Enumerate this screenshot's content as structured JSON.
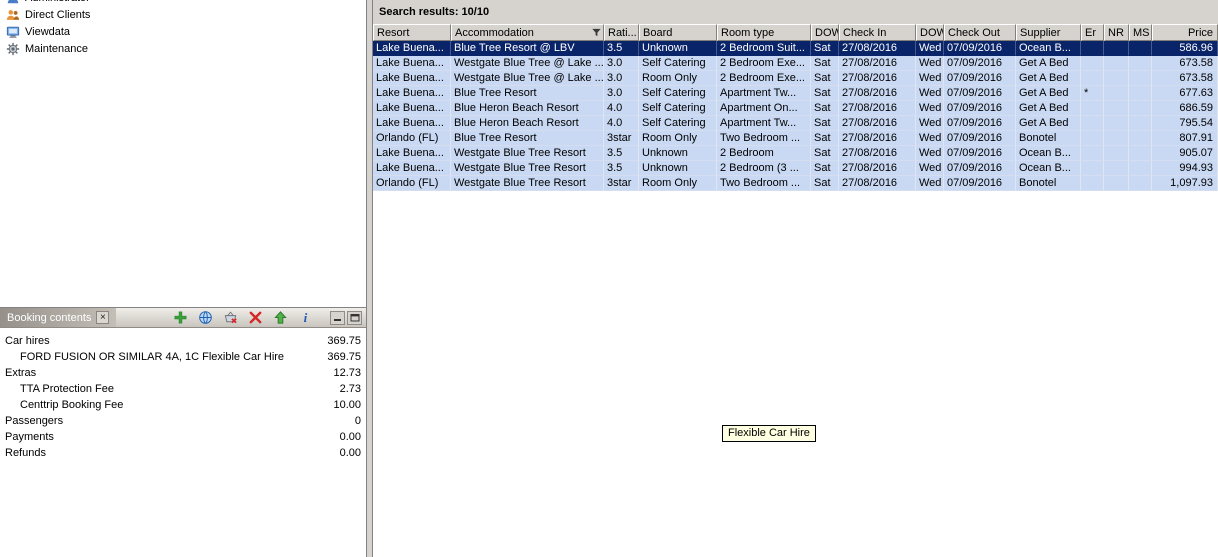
{
  "left_tree": {
    "items": [
      {
        "label": "Administrator",
        "icon": "user-icon",
        "clipped": true
      },
      {
        "label": "Direct Clients",
        "icon": "clients-icon",
        "clipped": false
      },
      {
        "label": "Viewdata",
        "icon": "viewdata-icon",
        "clipped": false
      },
      {
        "label": "Maintenance",
        "icon": "maintenance-icon",
        "clipped": false
      }
    ]
  },
  "booking_panel": {
    "title": "Booking contents",
    "close_glyph": "×",
    "toolbar": [
      {
        "icon": "add-icon"
      },
      {
        "icon": "globe-icon"
      },
      {
        "icon": "basket-remove-icon"
      },
      {
        "icon": "delete-icon"
      },
      {
        "icon": "upload-icon"
      },
      {
        "icon": "info-icon"
      }
    ],
    "rows": [
      {
        "label": "Car hires",
        "value": "369.75",
        "indent": 0
      },
      {
        "label": "FORD FUSION OR SIMILAR  4A, 1C Flexible Car Hire",
        "value": "369.75",
        "indent": 1
      },
      {
        "label": "Extras",
        "value": "12.73",
        "indent": 0
      },
      {
        "label": "TTA Protection Fee",
        "value": "2.73",
        "indent": 1
      },
      {
        "label": "Centtrip Booking Fee",
        "value": "10.00",
        "indent": 1
      },
      {
        "label": "Passengers",
        "value": "0",
        "indent": 0
      },
      {
        "label": "Payments",
        "value": "0.00",
        "indent": 0
      },
      {
        "label": "Refunds",
        "value": "0.00",
        "indent": 0
      }
    ]
  },
  "results": {
    "header": "Search results: 10/10",
    "columns": [
      {
        "label": "Resort"
      },
      {
        "label": "Accommodation",
        "filter": true
      },
      {
        "label": "Rati..."
      },
      {
        "label": "Board"
      },
      {
        "label": "Room type"
      },
      {
        "label": "DOW"
      },
      {
        "label": "Check In"
      },
      {
        "label": "DOW"
      },
      {
        "label": "Check Out"
      },
      {
        "label": "Supplier"
      },
      {
        "label": "Er"
      },
      {
        "label": "NR"
      },
      {
        "label": "MS"
      },
      {
        "label": "Price",
        "align": "right"
      }
    ],
    "selected_row": 0,
    "rows": [
      [
        "Lake Buena...",
        "Blue Tree Resort @ LBV",
        "3.5",
        "Unknown",
        "2 Bedroom Suit...",
        "Sat",
        "27/08/2016",
        "Wed",
        "07/09/2016",
        "Ocean B...",
        "",
        "",
        "",
        "586.96"
      ],
      [
        "Lake Buena...",
        "Westgate Blue Tree @ Lake ...",
        "3.0",
        "Self Catering",
        "2 Bedroom Exe...",
        "Sat",
        "27/08/2016",
        "Wed",
        "07/09/2016",
        "Get A Bed",
        "",
        "",
        "",
        "673.58"
      ],
      [
        "Lake Buena...",
        "Westgate Blue Tree @ Lake ...",
        "3.0",
        "Room Only",
        "2 Bedroom Exe...",
        "Sat",
        "27/08/2016",
        "Wed",
        "07/09/2016",
        "Get A Bed",
        "",
        "",
        "",
        "673.58"
      ],
      [
        "Lake Buena...",
        "Blue Tree Resort",
        "3.0",
        "Self Catering",
        "Apartment Tw...",
        "Sat",
        "27/08/2016",
        "Wed",
        "07/09/2016",
        "Get A Bed",
        "*",
        "",
        "",
        "677.63"
      ],
      [
        "Lake Buena...",
        "Blue Heron Beach Resort",
        "4.0",
        "Self Catering",
        "Apartment On...",
        "Sat",
        "27/08/2016",
        "Wed",
        "07/09/2016",
        "Get A Bed",
        "",
        "",
        "",
        "686.59"
      ],
      [
        "Lake Buena...",
        "Blue Heron Beach Resort",
        "4.0",
        "Self Catering",
        "Apartment Tw...",
        "Sat",
        "27/08/2016",
        "Wed",
        "07/09/2016",
        "Get A Bed",
        "",
        "",
        "",
        "795.54"
      ],
      [
        "Orlando (FL)",
        "Blue Tree Resort",
        "3star",
        "Room Only",
        "Two Bedroom ...",
        "Sat",
        "27/08/2016",
        "Wed",
        "07/09/2016",
        "Bonotel",
        "",
        "",
        "",
        "807.91"
      ],
      [
        "Lake Buena...",
        "Westgate Blue Tree Resort",
        "3.5",
        "Unknown",
        "2 Bedroom",
        "Sat",
        "27/08/2016",
        "Wed",
        "07/09/2016",
        "Ocean B...",
        "",
        "",
        "",
        "905.07"
      ],
      [
        "Lake Buena...",
        "Westgate Blue Tree Resort",
        "3.5",
        "Unknown",
        "2 Bedroom (3 ...",
        "Sat",
        "27/08/2016",
        "Wed",
        "07/09/2016",
        "Ocean B...",
        "",
        "",
        "",
        "994.93"
      ],
      [
        "Orlando (FL)",
        "Westgate Blue Tree Resort",
        "3star",
        "Room Only",
        "Two Bedroom ...",
        "Sat",
        "27/08/2016",
        "Wed",
        "07/09/2016",
        "Bonotel",
        "",
        "",
        "",
        "1,097.93"
      ]
    ]
  },
  "tooltip": {
    "text": "Flexible Car Hire"
  },
  "colors": {
    "selection": "#0a246a",
    "row_bg": "#c9d9f3",
    "chrome": "#d6d3ce"
  }
}
